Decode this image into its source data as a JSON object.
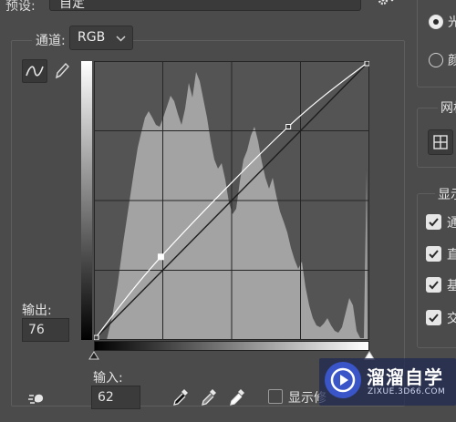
{
  "preset": {
    "label": "预设:",
    "value": "自定"
  },
  "channel": {
    "label": "通道:",
    "value": "RGB"
  },
  "output": {
    "label": "输出:",
    "value": "76"
  },
  "input": {
    "label": "输入:",
    "value": "62"
  },
  "show_clipping": {
    "label": "显示修"
  },
  "right_panel": {
    "radio_1": "光",
    "radio_2": "颜",
    "grid_section": "网格",
    "display_section": "显示",
    "check_1": "通",
    "check_2": "直",
    "check_3": "基",
    "check_4": "交"
  },
  "watermark": {
    "title": "溜溜自学",
    "url": "ZIXUE.3D66.COM"
  },
  "curve": {
    "points_in": [
      0,
      62,
      180,
      255
    ],
    "points_out": [
      0,
      76,
      195,
      255
    ]
  },
  "colors": {
    "graph_bg": "#545454",
    "histogram": "#a3a3a3",
    "grid": "#262626"
  },
  "icons": [
    "chevron-down-icon",
    "gear-icon",
    "curve-tool-icon",
    "pencil-icon",
    "eyedropper-black-icon",
    "eyedropper-gray-icon",
    "eyedropper-white-icon",
    "auto-adjust-icon",
    "black-point-slider-icon",
    "white-point-slider-icon",
    "grid-icon",
    "checkmark-icon"
  ]
}
